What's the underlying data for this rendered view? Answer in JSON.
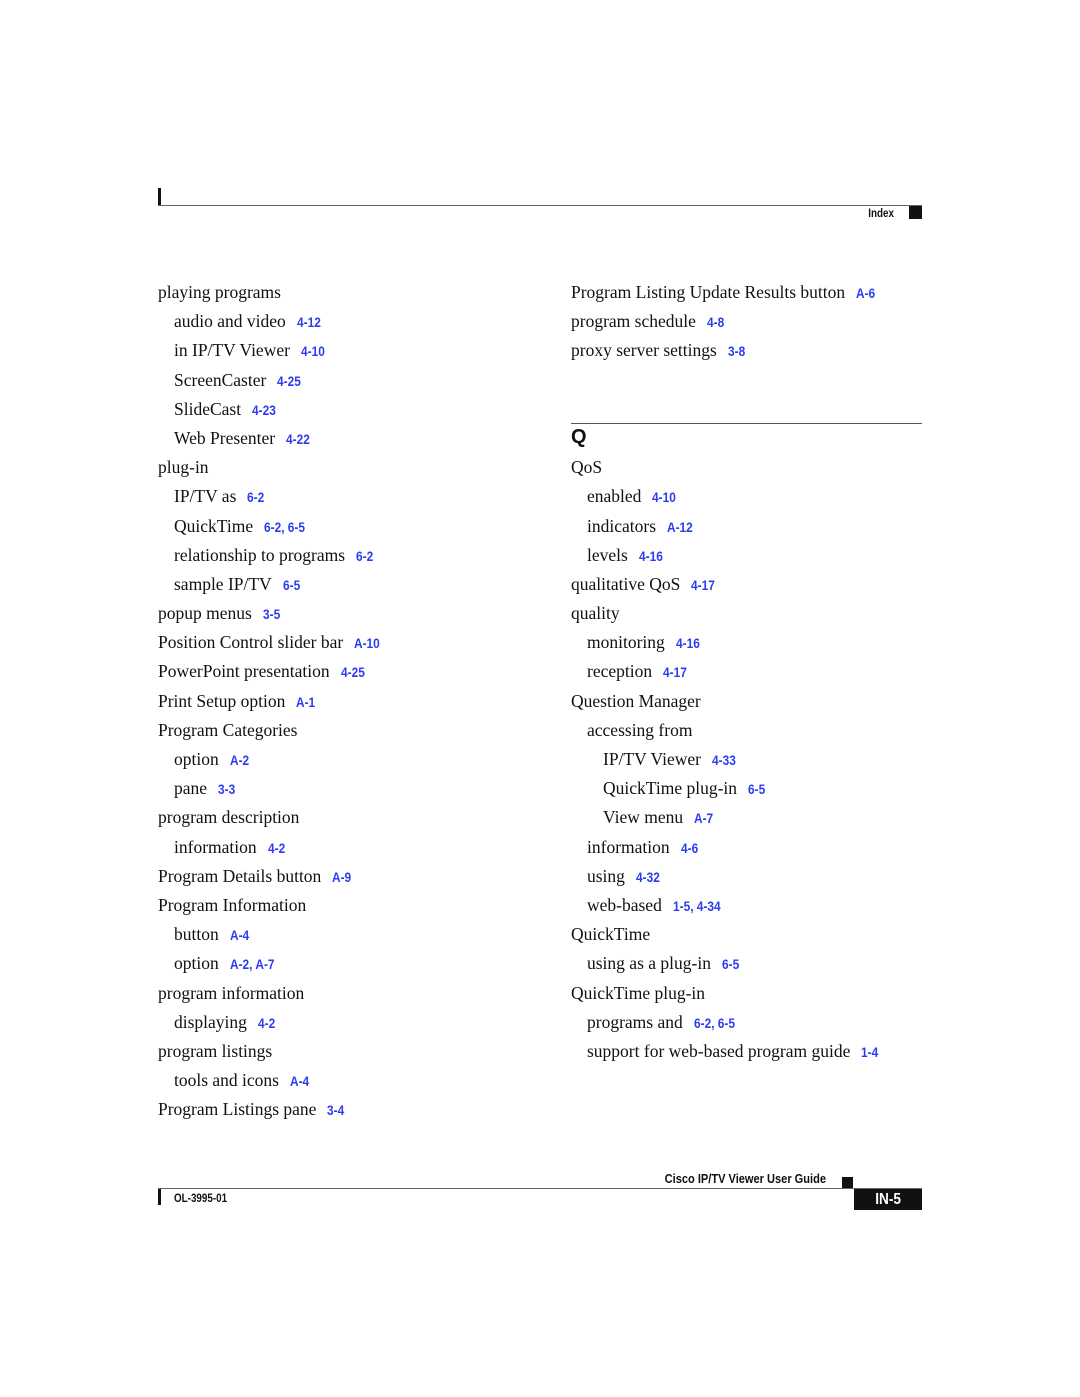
{
  "header": {
    "section_label": "Index"
  },
  "left_column": [
    {
      "level": 1,
      "term": "playing programs",
      "refs": ""
    },
    {
      "level": 2,
      "term": "audio and video",
      "refs": "4-12"
    },
    {
      "level": 2,
      "term": "in IP/TV Viewer",
      "refs": "4-10"
    },
    {
      "level": 2,
      "term": "ScreenCaster",
      "refs": "4-25"
    },
    {
      "level": 2,
      "term": "SlideCast",
      "refs": "4-23"
    },
    {
      "level": 2,
      "term": "Web Presenter",
      "refs": "4-22"
    },
    {
      "level": 1,
      "term": "plug-in",
      "refs": ""
    },
    {
      "level": 2,
      "term": "IP/TV as",
      "refs": "6-2"
    },
    {
      "level": 2,
      "term": "QuickTime",
      "refs": "6-2, 6-5"
    },
    {
      "level": 2,
      "term": "relationship to programs",
      "refs": "6-2"
    },
    {
      "level": 2,
      "term": "sample IP/TV",
      "refs": "6-5"
    },
    {
      "level": 1,
      "term": "popup menus",
      "refs": "3-5"
    },
    {
      "level": 1,
      "term": "Position Control slider bar",
      "refs": "A-10"
    },
    {
      "level": 1,
      "term": "PowerPoint presentation",
      "refs": "4-25"
    },
    {
      "level": 1,
      "term": "Print Setup option",
      "refs": "A-1"
    },
    {
      "level": 1,
      "term": "Program Categories",
      "refs": ""
    },
    {
      "level": 2,
      "term": "option",
      "refs": "A-2"
    },
    {
      "level": 2,
      "term": "pane",
      "refs": "3-3"
    },
    {
      "level": 1,
      "term": "program description",
      "refs": ""
    },
    {
      "level": 2,
      "term": "information",
      "refs": "4-2"
    },
    {
      "level": 1,
      "term": "Program Details button",
      "refs": "A-9"
    },
    {
      "level": 1,
      "term": "Program Information",
      "refs": ""
    },
    {
      "level": 2,
      "term": "button",
      "refs": "A-4"
    },
    {
      "level": 2,
      "term": "option",
      "refs": "A-2, A-7"
    },
    {
      "level": 1,
      "term": "program information",
      "refs": ""
    },
    {
      "level": 2,
      "term": "displaying",
      "refs": "4-2"
    },
    {
      "level": 1,
      "term": "program listings",
      "refs": ""
    },
    {
      "level": 2,
      "term": "tools and icons",
      "refs": "A-4"
    },
    {
      "level": 1,
      "term": "Program Listings pane",
      "refs": "3-4"
    }
  ],
  "right_column_top": [
    {
      "level": 1,
      "term": "Program Listing Update Results button",
      "refs": "A-6"
    },
    {
      "level": 1,
      "term": "program schedule",
      "refs": "4-8"
    },
    {
      "level": 1,
      "term": "proxy server settings",
      "refs": "3-8"
    }
  ],
  "section_q": {
    "letter": "Q"
  },
  "right_column_q": [
    {
      "level": 1,
      "term": "QoS",
      "refs": ""
    },
    {
      "level": 2,
      "term": "enabled",
      "refs": "4-10"
    },
    {
      "level": 2,
      "term": "indicators",
      "refs": "A-12"
    },
    {
      "level": 2,
      "term": "levels",
      "refs": "4-16"
    },
    {
      "level": 1,
      "term": "qualitative QoS",
      "refs": "4-17"
    },
    {
      "level": 1,
      "term": "quality",
      "refs": ""
    },
    {
      "level": 2,
      "term": "monitoring",
      "refs": "4-16"
    },
    {
      "level": 2,
      "term": "reception",
      "refs": "4-17"
    },
    {
      "level": 1,
      "term": "Question Manager",
      "refs": ""
    },
    {
      "level": 2,
      "term": "accessing from",
      "refs": ""
    },
    {
      "level": 3,
      "term": "IP/TV Viewer",
      "refs": "4-33"
    },
    {
      "level": 3,
      "term": "QuickTime plug-in",
      "refs": "6-5"
    },
    {
      "level": 3,
      "term": "View menu",
      "refs": "A-7"
    },
    {
      "level": 2,
      "term": "information",
      "refs": "4-6"
    },
    {
      "level": 2,
      "term": "using",
      "refs": "4-32"
    },
    {
      "level": 2,
      "term": "web-based",
      "refs": "1-5, 4-34"
    },
    {
      "level": 1,
      "term": "QuickTime",
      "refs": ""
    },
    {
      "level": 2,
      "term": "using as a plug-in",
      "refs": "6-5"
    },
    {
      "level": 1,
      "term": "QuickTime plug-in",
      "refs": ""
    },
    {
      "level": 2,
      "term": "programs and",
      "refs": "6-2, 6-5"
    },
    {
      "level": 2,
      "term": "support for web-based program guide",
      "refs": "1-4"
    }
  ],
  "footer": {
    "guide_title": "Cisco IP/TV Viewer User Guide",
    "doc_number": "OL-3995-01",
    "page_number": "IN-5"
  },
  "colors": {
    "link": "#2b3cf0",
    "text": "#111111"
  }
}
